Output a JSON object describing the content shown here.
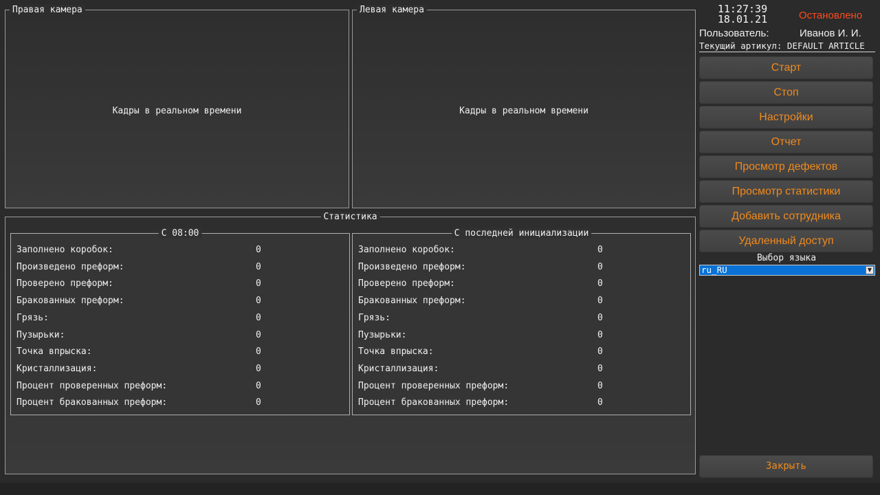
{
  "cameras": {
    "right": {
      "title": "Правая камера",
      "placeholder": "Кадры в реальном времени"
    },
    "left": {
      "title": "Левая камера",
      "placeholder": "Кадры в реальном времени"
    }
  },
  "statistics": {
    "title": "Статистика",
    "since_shift": {
      "title": "С 08:00",
      "rows": [
        {
          "label": "Заполнено коробок:",
          "value": "0"
        },
        {
          "label": "Произведено преформ:",
          "value": "0"
        },
        {
          "label": "Проверено преформ:",
          "value": "0"
        },
        {
          "label": "Бракованных преформ:",
          "value": "0"
        },
        {
          "label": "Грязь:",
          "value": "0"
        },
        {
          "label": "Пузырьки:",
          "value": "0"
        },
        {
          "label": "Точка впрыска:",
          "value": "0"
        },
        {
          "label": "Кристаллизация:",
          "value": "0"
        },
        {
          "label": "Процент проверенных преформ:",
          "value": "0"
        },
        {
          "label": "Процент бракованных преформ:",
          "value": "0"
        }
      ]
    },
    "since_init": {
      "title": "С последней инициализации",
      "rows": [
        {
          "label": "Заполнено коробок:",
          "value": "0"
        },
        {
          "label": "Произведено преформ:",
          "value": "0"
        },
        {
          "label": "Проверено преформ:",
          "value": "0"
        },
        {
          "label": "Бракованных преформ:",
          "value": "0"
        },
        {
          "label": "Грязь:",
          "value": "0"
        },
        {
          "label": "Пузырьки:",
          "value": "0"
        },
        {
          "label": "Точка впрыска:",
          "value": "0"
        },
        {
          "label": "Кристаллизация:",
          "value": "0"
        },
        {
          "label": "Процент проверенных преформ:",
          "value": "0"
        },
        {
          "label": "Процент бракованных преформ:",
          "value": "0"
        }
      ]
    }
  },
  "side_panel": {
    "time": "11:27:39",
    "date": "18.01.21",
    "status": "Остановлено",
    "status_color": "#ff4a1c",
    "user_label": "Пользователь:",
    "user_value": "Иванов И. И.",
    "article": "Текущий артикул: DEFAULT ARTICLE",
    "buttons": {
      "start": "Старт",
      "stop": "Стоп",
      "settings": "Настройки",
      "report": "Отчет",
      "defects": "Просмотр дефектов",
      "statistics": "Просмотр статистики",
      "add_employee": "Добавить сотрудника",
      "remote_access": "Удаленный доступ",
      "close": "Закрыть"
    },
    "button_text_color": "#f08a1e",
    "language_label": "Выбор языка",
    "language_value": "ru_RU",
    "language_arrow_icon": "chevron-down-icon"
  }
}
